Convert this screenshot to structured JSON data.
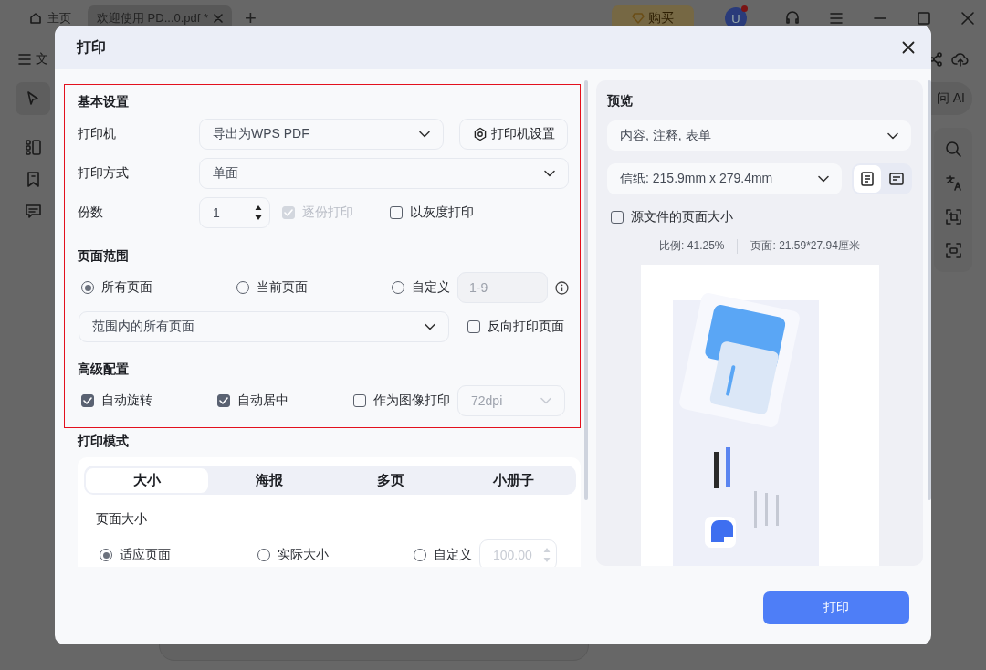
{
  "app": {
    "tabs": [
      {
        "kind": "home",
        "label": "主页",
        "selected": false
      },
      {
        "kind": "document",
        "label": "欢迎使用 PD...0.pdf *",
        "selected": true
      }
    ],
    "new_tab": "+",
    "buy_button": "购买",
    "avatar": "U",
    "menu_label": "文",
    "ai_button": "问 AI"
  },
  "dialog": {
    "title": "打印",
    "basic_settings": {
      "heading": "基本设置",
      "printer": {
        "label": "打印机",
        "value": "导出为WPS PDF"
      },
      "printer_settings_button": "打印机设置",
      "mode": {
        "label": "打印方式",
        "value": "单面"
      },
      "copies": {
        "label": "份数",
        "value": "1"
      },
      "options": [
        {
          "label": "逐份打印",
          "checked": true,
          "disabled": true
        },
        {
          "label": "以灰度打印",
          "checked": false,
          "disabled": false
        }
      ]
    },
    "page_range": {
      "heading": "页面范围",
      "choices": [
        {
          "label": "所有页面",
          "selected": true
        },
        {
          "label": "当前页面",
          "selected": false
        },
        {
          "label": "自定义",
          "selected": false
        }
      ],
      "custom_placeholder": "1-9",
      "subset": "范围内的所有页面",
      "reverse": {
        "label": "反向打印页面",
        "checked": false
      }
    },
    "advanced": {
      "heading": "高级配置",
      "options": [
        {
          "label": "自动旋转",
          "checked": true
        },
        {
          "label": "自动居中",
          "checked": true
        },
        {
          "label": "作为图像打印",
          "checked": false
        }
      ],
      "resolution": {
        "value": "72dpi",
        "disabled": true
      }
    },
    "print_mode": {
      "heading": "打印模式",
      "tabs": [
        {
          "label": "大小",
          "selected": true
        },
        {
          "label": "海报",
          "selected": false
        },
        {
          "label": "多页",
          "selected": false
        },
        {
          "label": "小册子",
          "selected": false
        }
      ],
      "page_size_heading": "页面大小",
      "choices": [
        {
          "label": "适应页面",
          "selected": true
        },
        {
          "label": "实际大小",
          "selected": false
        },
        {
          "label": "自定义",
          "selected": false
        }
      ],
      "custom_scale": {
        "value": "100.00",
        "disabled": true
      }
    },
    "preview": {
      "heading": "预览",
      "content": "内容, 注释, 表单",
      "paper": "信纸: 215.9mm x 279.4mm",
      "orientations": [
        {
          "kind": "portrait",
          "selected": true
        },
        {
          "kind": "landscape",
          "selected": false
        }
      ],
      "source_size": {
        "label": "源文件的页面大小",
        "checked": false
      },
      "scale": "比例: 41.25%",
      "page_size": "页面: 21.59*27.94厘米"
    },
    "print_button": "打印"
  }
}
